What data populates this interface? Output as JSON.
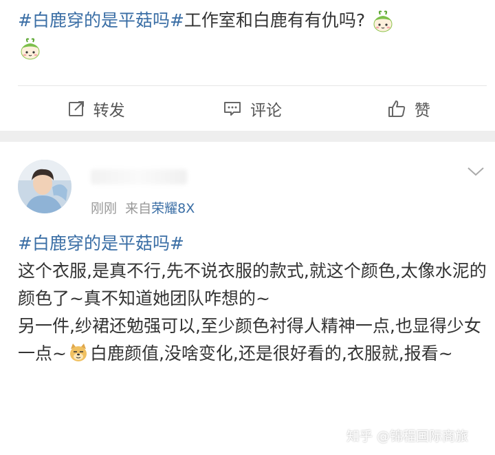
{
  "post1": {
    "topic": "#白鹿穿的是平菇吗#",
    "text": "工作室和白鹿有有仇吗?",
    "emoji_icon": "green-sprout-emoji"
  },
  "actions": {
    "repost_label": "转发",
    "comment_label": "评论",
    "like_label": "赞"
  },
  "post2": {
    "timestamp": "刚刚",
    "source_prefix": "来自",
    "source_device": "荣耀8X",
    "topic": "#白鹿穿的是平菇吗#",
    "line1": "这个衣服,是真不行,先不说衣服的款式,就这个颜色,太像水泥的颜色了~真不知道她团队咋想的~",
    "line2a": "另一件,纱裙还勉强可以,至少颜色衬得人精神一点,也显得少女一点~",
    "line2b": "白鹿颜值,没啥变化,还是很好看的,衣服就,报看~"
  },
  "watermark": "知乎 @锦程国际商旅",
  "colors": {
    "topic": "#3a6ea5",
    "text": "#333333",
    "meta": "#999999",
    "divider": "#eeeeee"
  }
}
